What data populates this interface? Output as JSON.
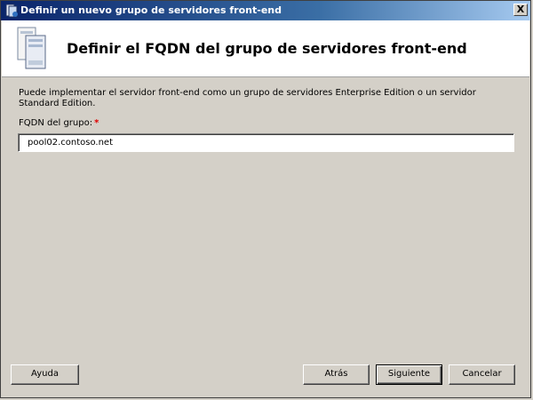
{
  "window": {
    "title": "Definir un nuevo grupo de servidores front-end",
    "close_label": "X"
  },
  "header": {
    "title": "Definir el FQDN del grupo de servidores front-end",
    "icon": "server-icon"
  },
  "content": {
    "description": "Puede implementar el servidor front-end como un grupo de servidores Enterprise Edition o un servidor Standard Edition.",
    "fqdn_label": "FQDN del grupo:",
    "required_marker": "*",
    "fqdn_value": "pool02.contoso.net"
  },
  "buttons": {
    "help": "Ayuda",
    "back": "Atrás",
    "next": "Siguiente",
    "cancel": "Cancelar"
  },
  "colors": {
    "titlebar_start": "#0a246a",
    "titlebar_end": "#a6caf0",
    "dialog_bg": "#d4d0c8",
    "required": "#e00000"
  }
}
